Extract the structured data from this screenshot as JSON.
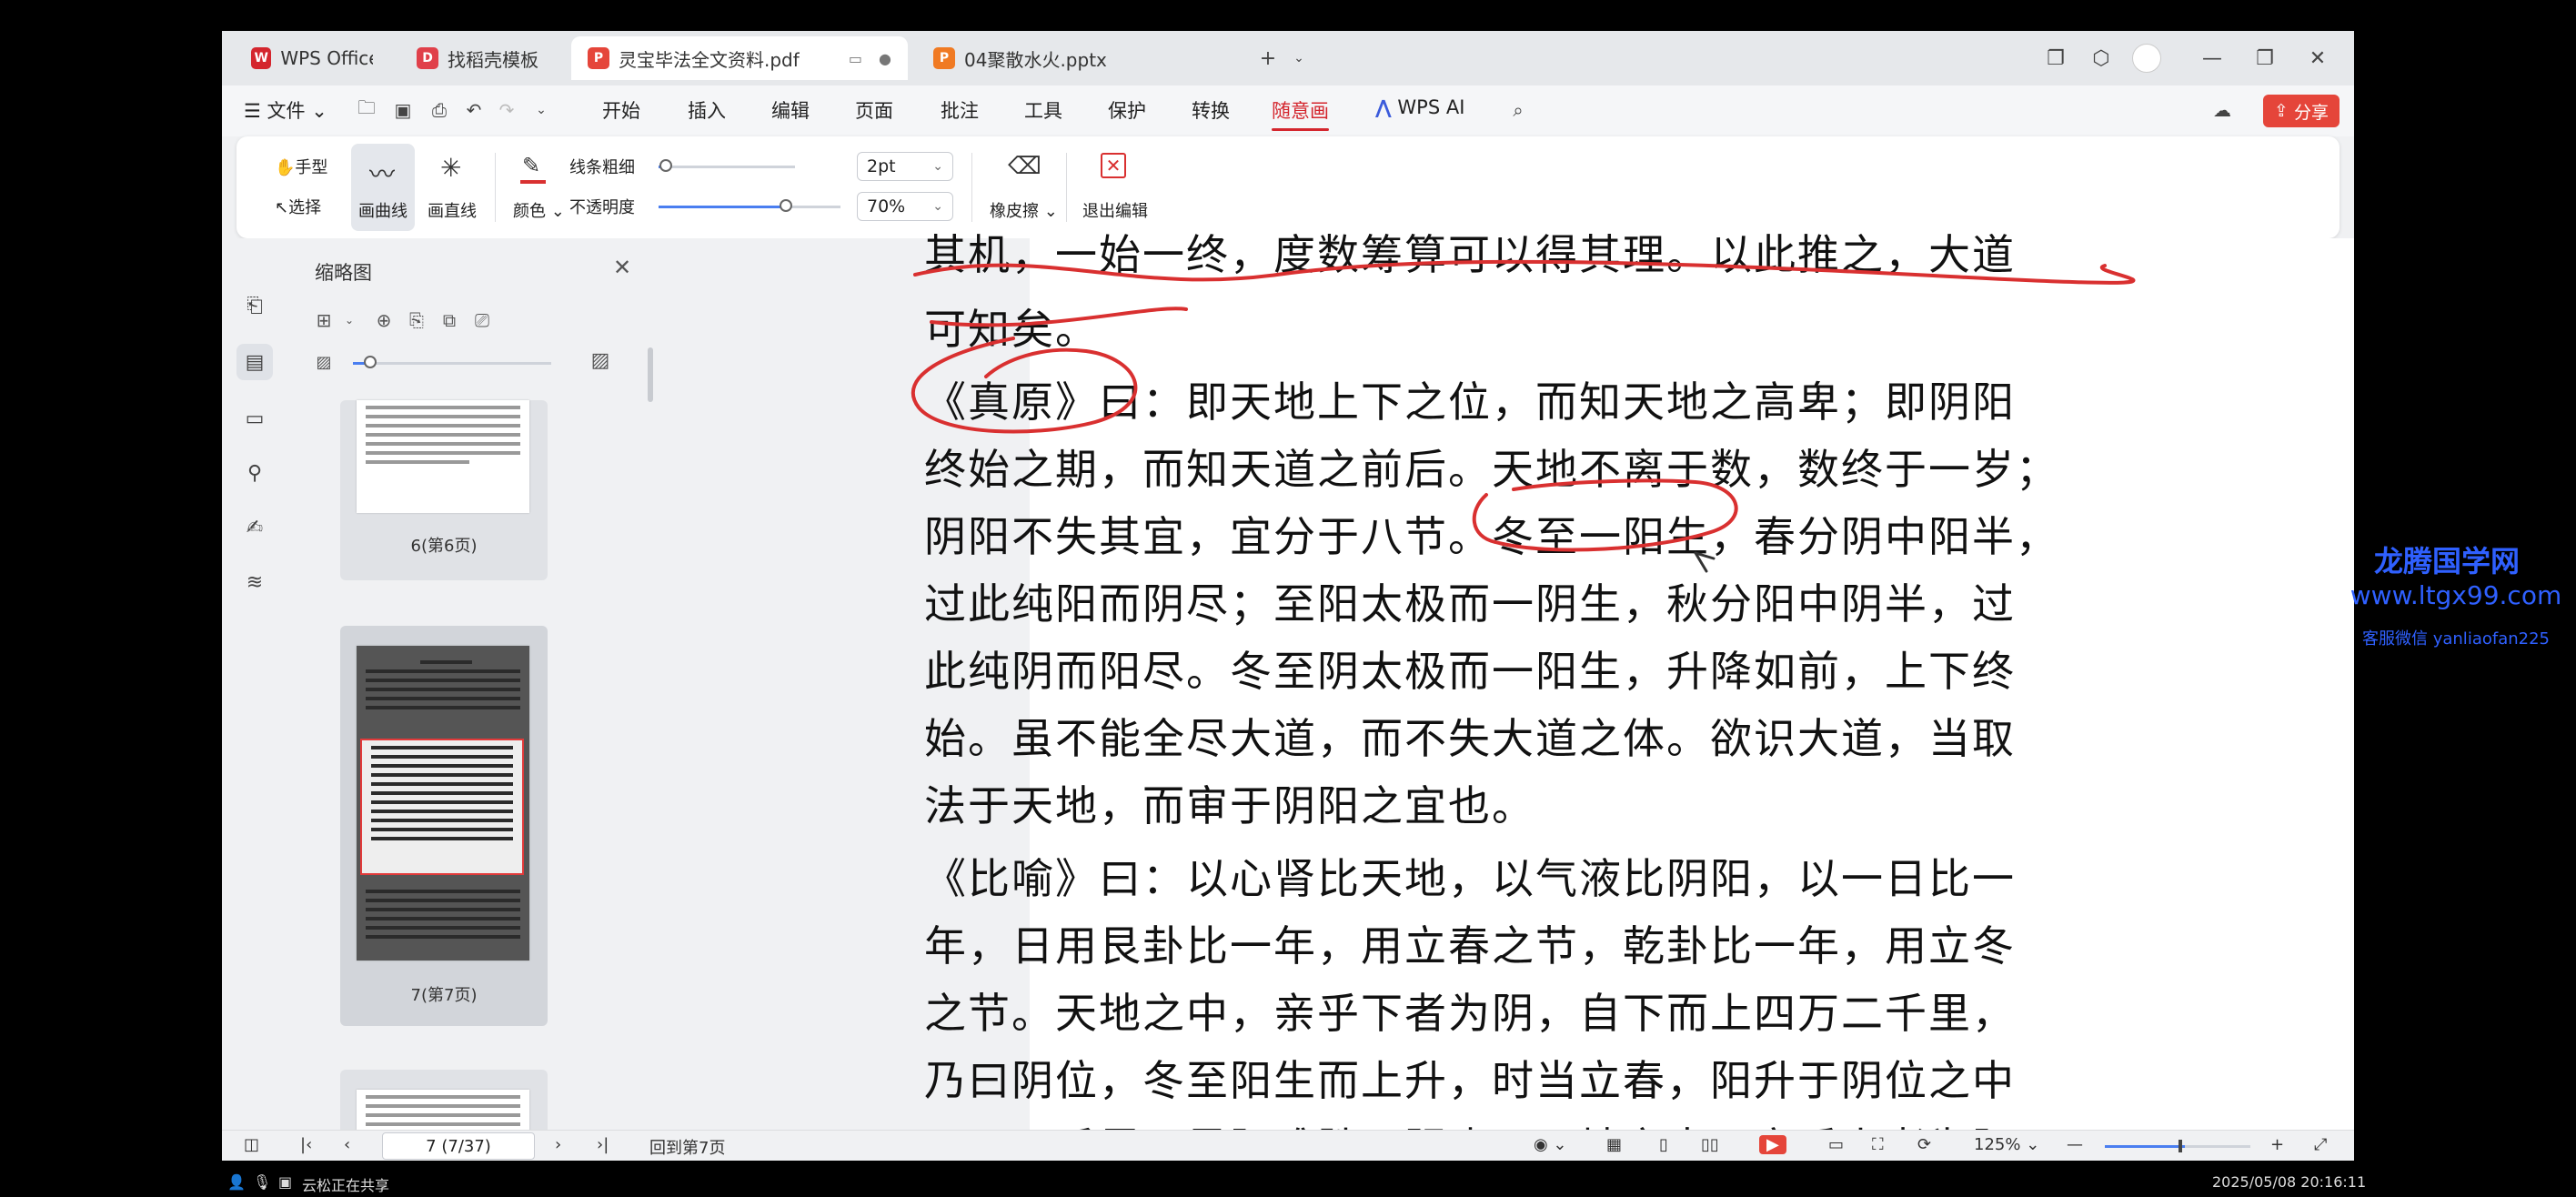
{
  "tabs": [
    {
      "label": "WPS Office",
      "icon": "wps-logo-icon",
      "color": "#d4262e"
    },
    {
      "label": "找稻壳模板",
      "icon": "docer-icon",
      "color": "#e0404a"
    },
    {
      "label": "灵宝毕法全文资料.pdf",
      "icon": "pdf-icon",
      "color": "#e5453a",
      "active": true
    },
    {
      "label": "04聚散水火.pptx",
      "icon": "ppt-icon",
      "color": "#f07a23"
    }
  ],
  "tab_add": "+",
  "menu": {
    "file": "文件",
    "items": [
      "开始",
      "插入",
      "编辑",
      "页面",
      "批注",
      "工具",
      "保护",
      "转换",
      "随意画"
    ],
    "active": "随意画",
    "wps_ai": "WPS AI",
    "share": "分享"
  },
  "ribbon": {
    "hand": "手型",
    "select": "选择",
    "curve": "画曲线",
    "straight": "画直线",
    "color": "颜色",
    "line_width_label": "线条粗细",
    "line_width_value": "2pt",
    "line_width_level": 0.05,
    "opacity_label": "不透明度",
    "opacity_value": "70%",
    "opacity_level": 0.7,
    "eraser": "橡皮擦",
    "exit": "退出编辑"
  },
  "thumbnails": {
    "title": "缩略图",
    "pages": [
      {
        "caption": "6(第6页)"
      },
      {
        "caption": "7(第7页)",
        "selected": true
      },
      {
        "caption": ""
      }
    ]
  },
  "document": {
    "lines": [
      "其机，一始一终，度数筹算可以得其理。以此推之，大道",
      "可知矣。",
      "《真原》曰：即天地上下之位，而知天地之高卑；即阴阳",
      "终始之期，而知天道之前后。天地不离于数，数终于一岁；",
      "阴阳不失其宜，宜分于八节。冬至一阳生，春分阴中阳半，",
      "过此纯阳而阴尽；至阳太极而一阴生，秋分阳中阴半，过",
      "此纯阴而阳尽。冬至阴太极而一阳生，升降如前，上下终",
      "始。虽不能全尽大道，而不失大道之体。欲识大道，当取",
      "法于天地，而审于阴阳之宜也。",
      "《比喻》曰：以心肾比天地，以气液比阴阳，以一日比一",
      "年，日用艮卦比一年，用立春之节，乾卦比一年，用立冬",
      "之节。天地之中，亲乎下者为阴，自下而上四万二千里，",
      "乃曰阴位，冬至阳生而上升，时当立春，阳升于阴位之中",
      "二万一千里，是阳难胜于阴也。天地之中，亲乎上者为阳，"
    ],
    "annotation_color": "#d93030"
  },
  "status": {
    "page_input": "7 (7/37)",
    "back": "回到第7页",
    "zoom": "125%",
    "zoom_level": 0.55
  },
  "os": {
    "share_text": "云松正在共享",
    "datetime": "2025/05/08 20:16:11"
  },
  "watermark": {
    "line1": "龙腾国学网",
    "line2": "www.ltgx99.com",
    "line3": "客服微信 yanliaofan225"
  }
}
